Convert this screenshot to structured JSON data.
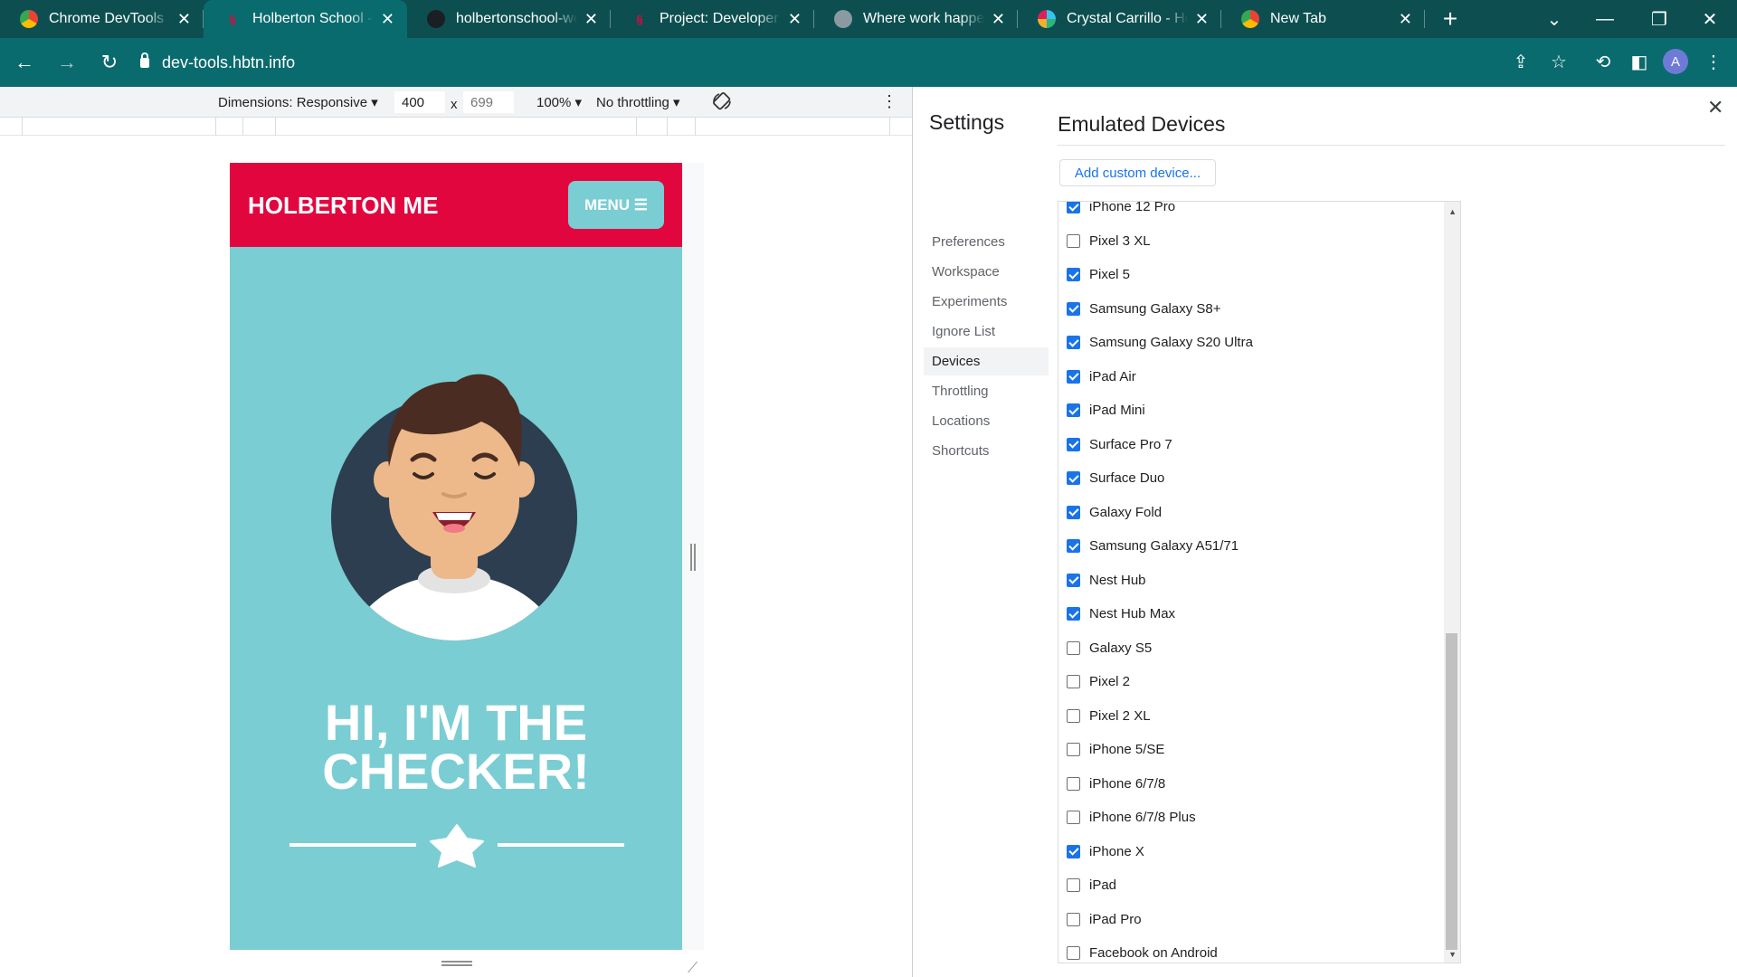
{
  "tabs": [
    {
      "title": "Chrome DevTools - C",
      "icon": "chrome-icon",
      "active": false
    },
    {
      "title": "Holberton School - D",
      "icon": "holberton-icon",
      "active": true
    },
    {
      "title": "holbertonschool-web",
      "icon": "github-icon",
      "active": false
    },
    {
      "title": "Project: Developer to",
      "icon": "holberton-icon",
      "active": false
    },
    {
      "title": "Where work happens",
      "icon": "globe-icon",
      "active": false
    },
    {
      "title": "Crystal Carrillo - Holb",
      "icon": "slack-icon",
      "active": false
    },
    {
      "title": "New Tab",
      "icon": "chrome-icon",
      "active": false
    }
  ],
  "address": {
    "url": "dev-tools.hbtn.info"
  },
  "profile": {
    "initial": "A"
  },
  "device_toolbar": {
    "dimensions": "Dimensions: Responsive",
    "width": "400",
    "x": "x",
    "height_placeholder": "699",
    "zoom": "100%",
    "throttling": "No throttling"
  },
  "site": {
    "logo": "HOLBERTON ME",
    "menu": "MENU",
    "headline": "HI, I'M THE CHECKER!"
  },
  "settings": {
    "title": "Settings",
    "nav": [
      "Preferences",
      "Workspace",
      "Experiments",
      "Ignore List",
      "Devices",
      "Throttling",
      "Locations",
      "Shortcuts"
    ],
    "selected": "Devices",
    "panel_title": "Emulated Devices",
    "add_button": "Add custom device...",
    "devices": [
      {
        "name": "iPhone 12 Pro",
        "checked": true
      },
      {
        "name": "Pixel 3 XL",
        "checked": false
      },
      {
        "name": "Pixel 5",
        "checked": true
      },
      {
        "name": "Samsung Galaxy S8+",
        "checked": true
      },
      {
        "name": "Samsung Galaxy S20 Ultra",
        "checked": true
      },
      {
        "name": "iPad Air",
        "checked": true
      },
      {
        "name": "iPad Mini",
        "checked": true
      },
      {
        "name": "Surface Pro 7",
        "checked": true
      },
      {
        "name": "Surface Duo",
        "checked": true
      },
      {
        "name": "Galaxy Fold",
        "checked": true
      },
      {
        "name": "Samsung Galaxy A51/71",
        "checked": true
      },
      {
        "name": "Nest Hub",
        "checked": true
      },
      {
        "name": "Nest Hub Max",
        "checked": true
      },
      {
        "name": "Galaxy S5",
        "checked": false
      },
      {
        "name": "Pixel 2",
        "checked": false
      },
      {
        "name": "Pixel 2 XL",
        "checked": false
      },
      {
        "name": "iPhone 5/SE",
        "checked": false
      },
      {
        "name": "iPhone 6/7/8",
        "checked": false
      },
      {
        "name": "iPhone 6/7/8 Plus",
        "checked": false
      },
      {
        "name": "iPhone X",
        "checked": true
      },
      {
        "name": "iPad",
        "checked": false
      },
      {
        "name": "iPad Pro",
        "checked": false
      },
      {
        "name": "Facebook on Android",
        "checked": false
      }
    ]
  },
  "colors": {
    "brand_red": "#e2063f",
    "brand_teal": "#7acdd3",
    "chrome_dark": "#0d4f50",
    "chrome_tab": "#0a6b6e",
    "accent_blue": "#1a73e8"
  }
}
